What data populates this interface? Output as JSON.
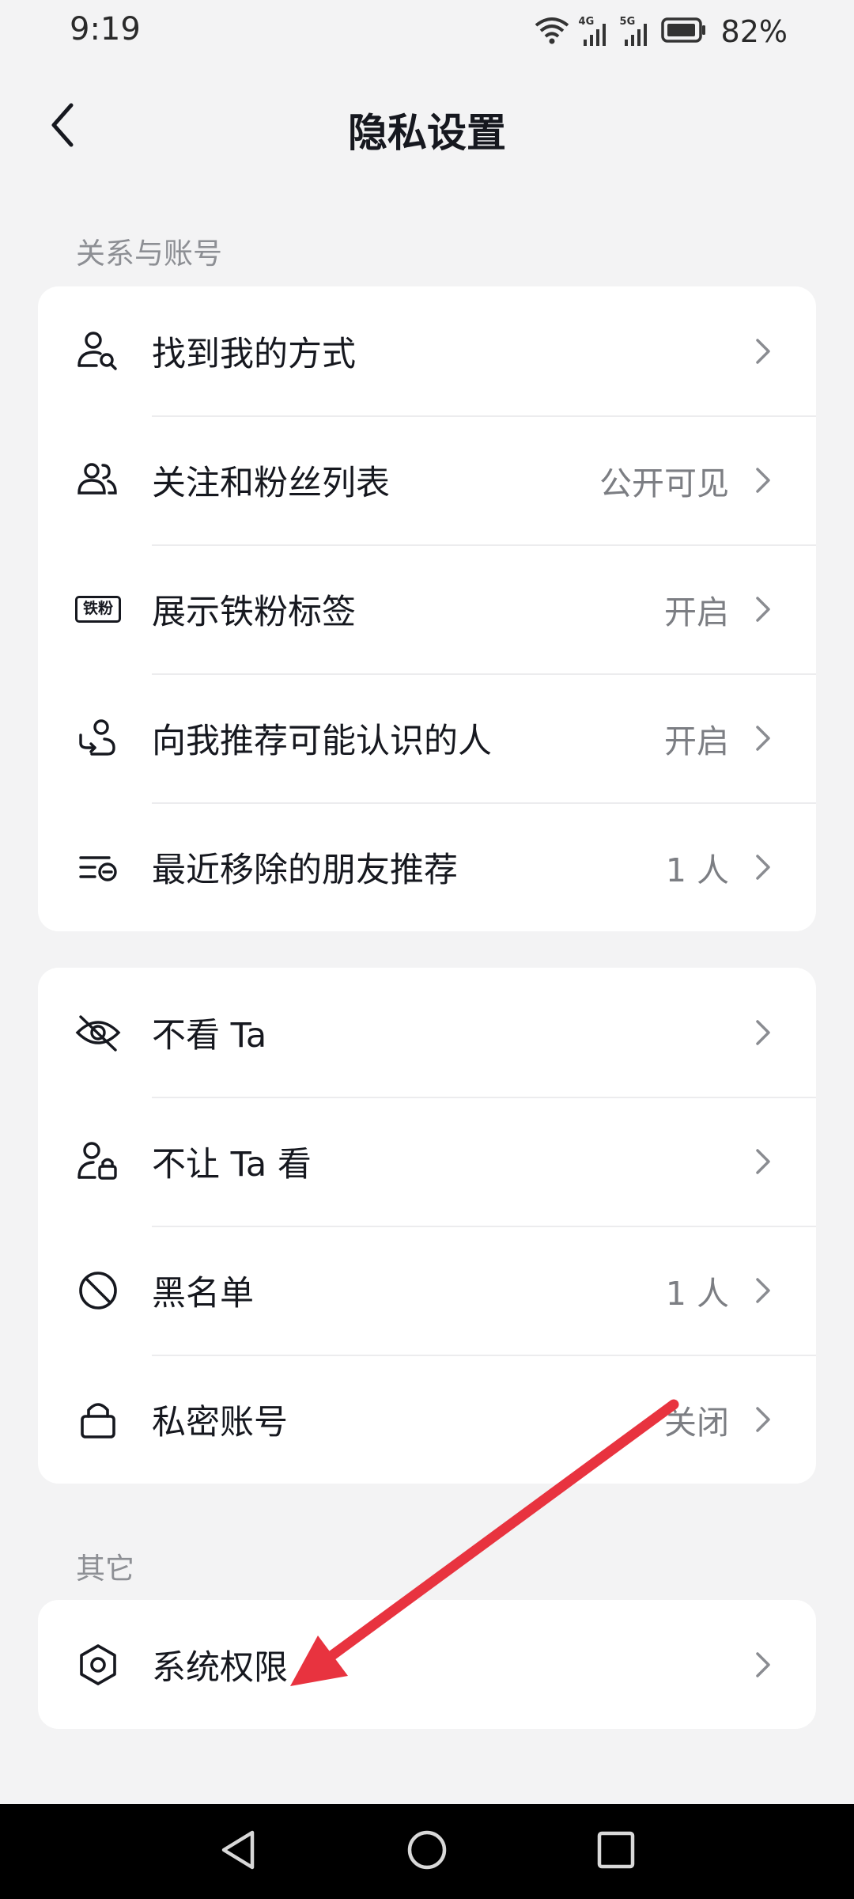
{
  "status_bar": {
    "time": "9:19",
    "battery_percent": "82%",
    "network_1": "4G",
    "network_2": "5G",
    "icons": [
      "wifi-icon",
      "signal-4g-icon",
      "signal-5g-icon",
      "battery-icon"
    ]
  },
  "header": {
    "title": "隐私设置",
    "back_icon": "chevron-left-icon"
  },
  "sections": {
    "relations_label": "关系与账号",
    "other_label": "其它"
  },
  "group1": [
    {
      "label": "找到我的方式",
      "value": "",
      "icon": "person-search-icon"
    },
    {
      "label": "关注和粉丝列表",
      "value": "公开可见",
      "icon": "people-icon"
    },
    {
      "label": "展示铁粉标签",
      "value": "开启",
      "icon": "iron-fan-badge-icon",
      "badge_text": "铁粉"
    },
    {
      "label": "向我推荐可能认识的人",
      "value": "开启",
      "icon": "person-recommend-icon"
    },
    {
      "label": "最近移除的朋友推荐",
      "value": "1 人",
      "icon": "list-remove-icon"
    }
  ],
  "group2": [
    {
      "label": "不看 Ta",
      "value": "",
      "icon": "eye-off-icon"
    },
    {
      "label": "不让 Ta 看",
      "value": "",
      "icon": "person-lock-icon"
    },
    {
      "label": "黑名单",
      "value": "1 人",
      "icon": "block-icon"
    },
    {
      "label": "私密账号",
      "value": "关闭",
      "icon": "lock-icon"
    }
  ],
  "group3": [
    {
      "label": "系统权限",
      "value": "",
      "icon": "hexagon-settings-icon"
    }
  ],
  "colors": {
    "background": "#f3f3f4",
    "card": "#ffffff",
    "text": "#16181f",
    "secondary_text": "#7c7e83",
    "annotation_arrow": "#e8333f"
  },
  "nav_bar": {
    "icons": [
      "nav-back-icon",
      "nav-home-icon",
      "nav-recents-icon"
    ]
  }
}
